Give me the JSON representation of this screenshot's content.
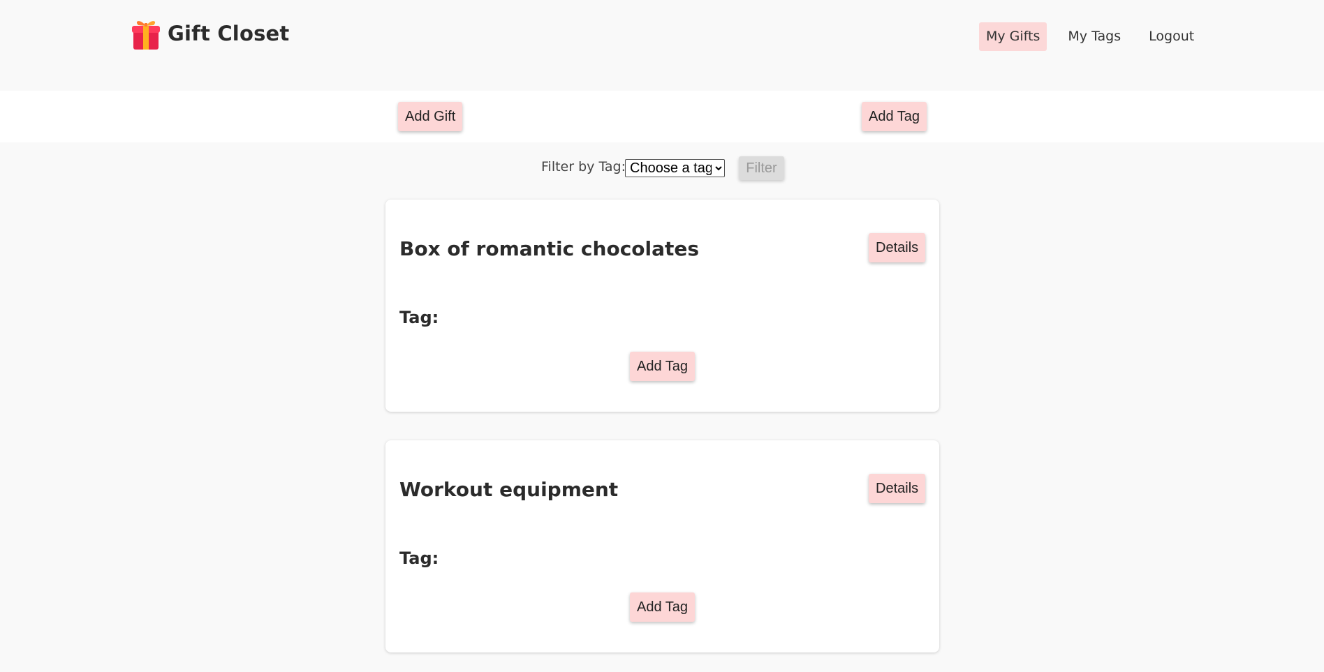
{
  "brand": {
    "title": "Gift Closet",
    "icon": "gift-icon",
    "icon_colors": {
      "box": "#e8234a",
      "lid": "#ff3b5c",
      "ribbon": "#ffb020",
      "bow": "#ff7a2e"
    }
  },
  "nav": {
    "items": [
      {
        "label": "My Gifts",
        "active": true
      },
      {
        "label": "My Tags",
        "active": false
      },
      {
        "label": "Logout",
        "active": false
      }
    ]
  },
  "actions": {
    "add_gift_label": "Add Gift",
    "add_tag_label": "Add Tag"
  },
  "filter": {
    "label": "Filter by Tag:",
    "select_value": "Choose a tag",
    "button_label": "Filter",
    "button_disabled": true
  },
  "gifts": [
    {
      "name": "Box of romantic chocolates",
      "details_label": "Details",
      "tag_label": "Tag:",
      "add_tag_label": "Add Tag"
    },
    {
      "name": "Workout equipment",
      "details_label": "Details",
      "tag_label": "Tag:",
      "add_tag_label": "Add Tag"
    }
  ],
  "colors": {
    "accent_pink": "#fdd6d6",
    "page_background": "#f9f9f9",
    "card_background": "#ffffff",
    "disabled_button": "#dcdcdc"
  }
}
